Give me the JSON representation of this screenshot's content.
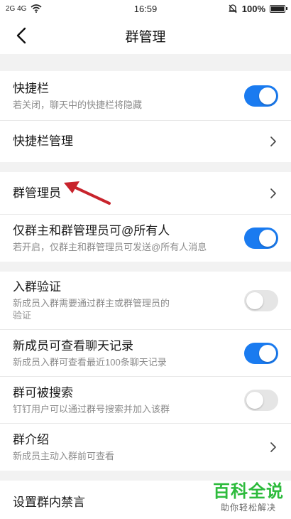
{
  "status": {
    "left": "2G 4G",
    "time": "16:59",
    "battery": "100%"
  },
  "nav": {
    "title": "群管理"
  },
  "rows": {
    "quickbar": {
      "title": "快捷栏",
      "sub": "若关闭，聊天中的快捷栏将隐藏",
      "on": true
    },
    "quickbar_manage": {
      "title": "快捷栏管理"
    },
    "group_admin": {
      "title": "群管理员"
    },
    "at_all": {
      "title": "仅群主和群管理员可@所有人",
      "sub": "若开启，仅群主和群管理员可发送@所有人消息",
      "on": true
    },
    "join_verify": {
      "title": "入群验证",
      "sub": "新成员入群需要通过群主或群管理员的验证",
      "on": false
    },
    "history": {
      "title": "新成员可查看聊天记录",
      "sub": "新成员入群可查看最近100条聊天记录",
      "on": true
    },
    "searchable": {
      "title": "群可被搜索",
      "sub": "钉钉用户可以通过群号搜索并加入该群",
      "on": false
    },
    "intro": {
      "title": "群介绍",
      "sub": "新成员主动入群前可查看"
    },
    "mute": {
      "title": "设置群内禁言"
    }
  },
  "watermark": {
    "main": "百科全说",
    "sub": "助你轻松解决"
  },
  "colors": {
    "accent": "#1a7bf0",
    "arrow": "#c8232c",
    "watermark": "#2dbb3c"
  }
}
